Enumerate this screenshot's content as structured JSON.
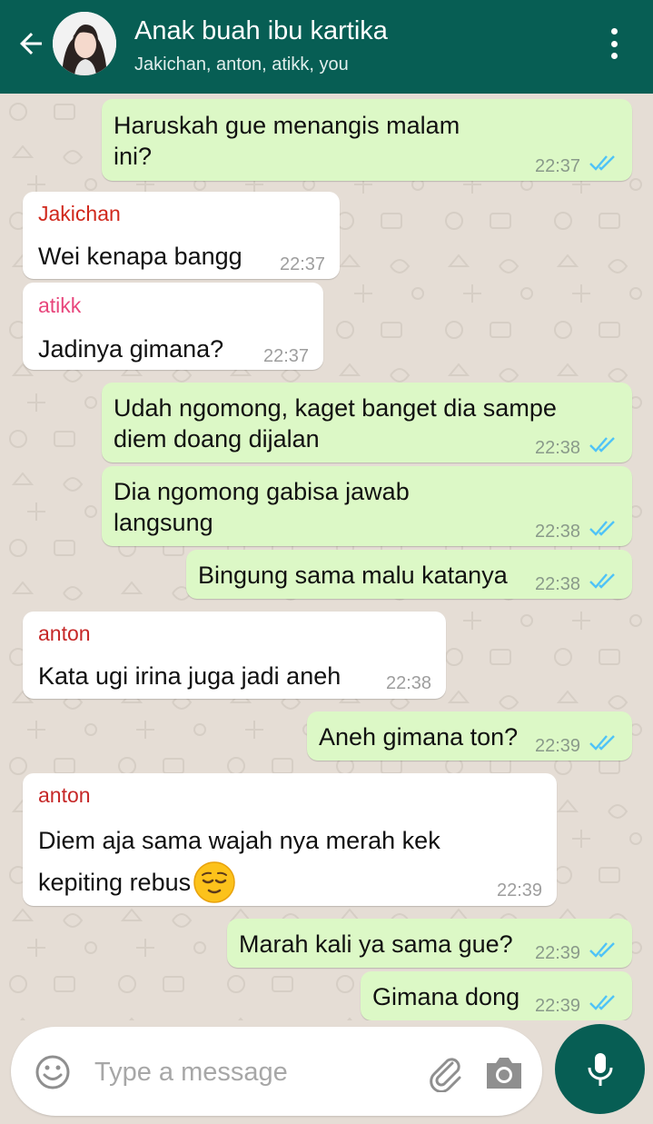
{
  "header": {
    "title": "Anak buah ibu kartika",
    "members": "Jakichan, anton, atikk, you"
  },
  "colors": {
    "header_bg": "#075e54",
    "outgoing_bubble": "#dcf8c6",
    "incoming_bubble": "#ffffff",
    "read_ticks": "#4fc3f7",
    "sender_jakichan": "#d0281c",
    "sender_atikk": "#e8467c",
    "sender_anton": "#c62828"
  },
  "messages": [
    {
      "dir": "out",
      "lines": [
        "Haruskah gue menangis malam",
        "ini?"
      ],
      "time": "22:37",
      "status": "read"
    },
    {
      "dir": "in",
      "sender": "Jakichan",
      "lines": [
        "Wei kenapa bangg"
      ],
      "time": "22:37"
    },
    {
      "dir": "in",
      "sender": "atikk",
      "lines": [
        "Jadinya gimana?"
      ],
      "time": "22:37"
    },
    {
      "dir": "out",
      "lines": [
        "Udah ngomong, kaget banget dia sampe",
        "diem doang dijalan"
      ],
      "time": "22:38",
      "status": "read"
    },
    {
      "dir": "out",
      "lines": [
        "Dia ngomong gabisa jawab",
        "langsung"
      ],
      "time": "22:38",
      "status": "read"
    },
    {
      "dir": "out",
      "lines": [
        "Bingung sama malu katanya"
      ],
      "time": "22:38",
      "status": "read"
    },
    {
      "dir": "in",
      "sender": "anton",
      "lines": [
        "Kata ugi irina juga jadi aneh"
      ],
      "time": "22:38"
    },
    {
      "dir": "out",
      "lines": [
        "Aneh gimana ton?"
      ],
      "time": "22:39",
      "status": "read"
    },
    {
      "dir": "in",
      "sender": "anton",
      "lines": [
        "Diem aja sama wajah nya merah kek",
        "kepiting rebus"
      ],
      "emoji": "relieved-face",
      "time": "22:39"
    },
    {
      "dir": "out",
      "lines": [
        "Marah kali ya sama gue?"
      ],
      "time": "22:39",
      "status": "read"
    },
    {
      "dir": "out",
      "lines": [
        "Gimana dong"
      ],
      "time": "22:39",
      "status": "read"
    }
  ],
  "composer": {
    "placeholder": "Type a message",
    "value": ""
  },
  "icons": {
    "back": "arrow-left-icon",
    "menu": "more-vertical-icon",
    "emoji": "smiley-icon",
    "attach": "paperclip-icon",
    "camera": "camera-icon",
    "mic": "microphone-icon"
  }
}
